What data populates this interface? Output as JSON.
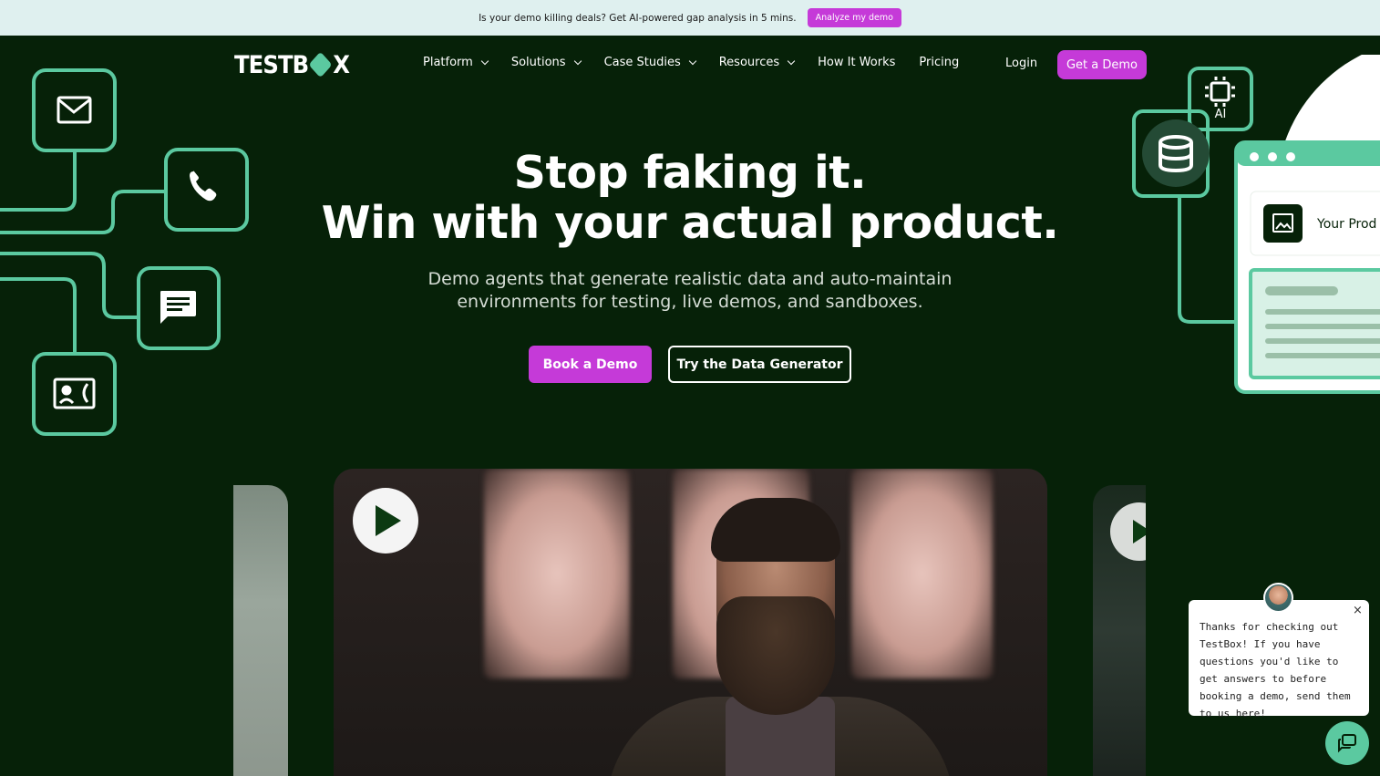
{
  "announcement": {
    "text": "Is your demo killing deals? Get AI-powered gap analysis in 5 mins.",
    "cta": "Analyze my demo"
  },
  "brand": {
    "logo_left": "TESTB",
    "logo_right": "X",
    "accent": "#c53ad8",
    "mint": "#5bc9a0",
    "background": "#062108"
  },
  "nav": {
    "items": [
      {
        "label": "Platform",
        "dropdown": true
      },
      {
        "label": "Solutions",
        "dropdown": true
      },
      {
        "label": "Case Studies",
        "dropdown": true
      },
      {
        "label": "Resources",
        "dropdown": true
      },
      {
        "label": "How It Works",
        "dropdown": false
      },
      {
        "label": "Pricing",
        "dropdown": false
      }
    ],
    "login": "Login",
    "cta": "Get a Demo"
  },
  "hero": {
    "title_line1": "Stop faking it.",
    "title_line2": "Win with your actual product.",
    "subtitle_line1": "Demo agents that generate realistic data and auto-maintain",
    "subtitle_line2": "environments for testing, live demos, and sandboxes.",
    "primary_cta": "Book a Demo",
    "secondary_cta": "Try the Data Generator"
  },
  "illustration": {
    "left_icons": [
      "mail-icon",
      "phone-icon",
      "chat-icon",
      "contact-card-icon"
    ],
    "right": {
      "ai_label": "AI",
      "product_label": "Your Prod",
      "icons": [
        "chip-icon",
        "database-icon",
        "image-icon"
      ]
    }
  },
  "chat": {
    "message": "Thanks for checking out TestBox! If you have questions you'd like to get answers to before booking a demo, send them to us here!",
    "close_glyph": "×"
  }
}
